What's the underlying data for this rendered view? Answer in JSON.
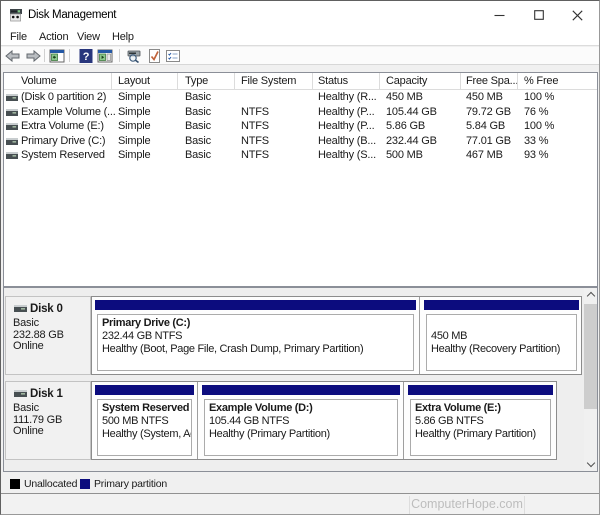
{
  "window": {
    "title": "Disk Management"
  },
  "menu": {
    "items": [
      "File",
      "Action",
      "View",
      "Help"
    ]
  },
  "toolbar": {
    "buttons": [
      "back",
      "forward",
      "show-console-tree",
      "help",
      "show-action-pane",
      "rescan-disks",
      "check",
      "properties"
    ]
  },
  "table": {
    "columns": [
      "Volume",
      "Layout",
      "Type",
      "File System",
      "Status",
      "Capacity",
      "Free Spa...",
      "% Free"
    ],
    "rows": [
      {
        "cells": [
          "(Disk 0 partition 2)",
          "Simple",
          "Basic",
          "",
          "Healthy (R...",
          "450 MB",
          "450 MB",
          "100 %"
        ]
      },
      {
        "cells": [
          "Example Volume (...",
          "Simple",
          "Basic",
          "NTFS",
          "Healthy (P...",
          "105.44 GB",
          "79.72 GB",
          "76 %"
        ]
      },
      {
        "cells": [
          "Extra Volume (E:)",
          "Simple",
          "Basic",
          "NTFS",
          "Healthy (P...",
          "5.86 GB",
          "5.84 GB",
          "100 %"
        ]
      },
      {
        "cells": [
          "Primary Drive (C:)",
          "Simple",
          "Basic",
          "NTFS",
          "Healthy (B...",
          "232.44 GB",
          "77.01 GB",
          "33 %"
        ]
      },
      {
        "cells": [
          "System Reserved",
          "Simple",
          "Basic",
          "NTFS",
          "Healthy (S...",
          "500 MB",
          "467 MB",
          "93 %"
        ]
      }
    ]
  },
  "disks": [
    {
      "name": "Disk 0",
      "type": "Basic",
      "size": "232.88 GB",
      "status": "Online",
      "partitions": [
        {
          "name": "Primary Drive  (C:)",
          "size": "232.44 GB NTFS",
          "status": "Healthy (Boot, Page File, Crash Dump, Primary Partition)"
        },
        {
          "name": "",
          "size": "450 MB",
          "status": "Healthy (Recovery Partition)"
        }
      ]
    },
    {
      "name": "Disk 1",
      "type": "Basic",
      "size": "111.79 GB",
      "status": "Online",
      "partitions": [
        {
          "name": "System Reserved",
          "size": "500 MB NTFS",
          "status": "Healthy (System, Act"
        },
        {
          "name": "Example Volume  (D:)",
          "size": "105.44 GB NTFS",
          "status": "Healthy (Primary Partition)"
        },
        {
          "name": "Extra Volume  (E:)",
          "size": "5.86 GB NTFS",
          "status": "Healthy (Primary Partition)"
        }
      ]
    }
  ],
  "legend": {
    "items": [
      {
        "label": "Unallocated",
        "color": "#000000"
      },
      {
        "label": "Primary partition",
        "color": "#0c0c7e"
      }
    ]
  },
  "colors": {
    "partition_bar": "#0c0c7e"
  },
  "statusbar": {
    "watermark": "ComputerHope.com"
  }
}
